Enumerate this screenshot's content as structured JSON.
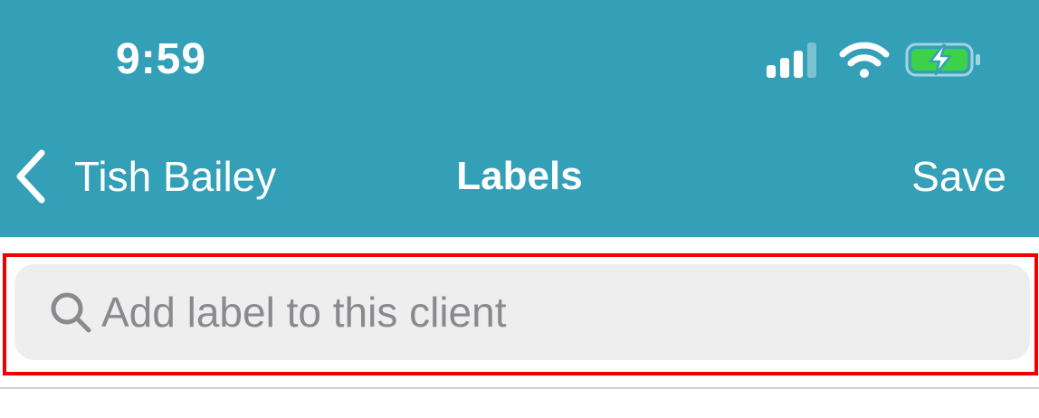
{
  "status_bar": {
    "time": "9:59",
    "icons": [
      "cellular-signal-icon",
      "wifi-icon",
      "battery-charging-icon"
    ],
    "battery_color": "#3dd14a"
  },
  "nav": {
    "back_label": "Tish Bailey",
    "title": "Labels",
    "save_label": "Save"
  },
  "search": {
    "placeholder": "Add label to this client",
    "value": ""
  },
  "colors": {
    "header_bg": "#33a0b8",
    "highlight": "#ee0000",
    "search_bg": "#eeeeef"
  }
}
